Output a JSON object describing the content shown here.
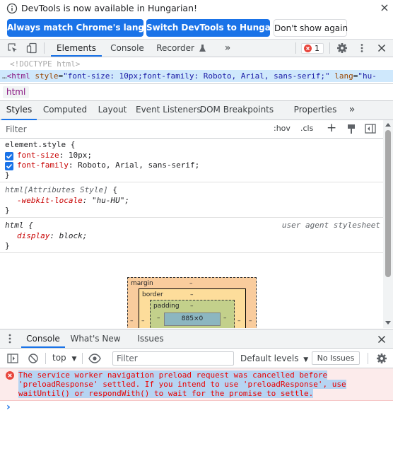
{
  "infobar": {
    "message": "DevTools is now available in Hungarian!",
    "match_button": "Always match Chrome's language",
    "switch_button": "Switch DevTools to Hungarian",
    "dont_show_button": "Don't show again",
    "close_symbol": "×"
  },
  "main_tabs": {
    "elements": "Elements",
    "console": "Console",
    "recorder": "Recorder",
    "more": "»",
    "error_count": "1"
  },
  "dom_tree": {
    "doctype": "<!DOCTYPE html>",
    "ellipsis": "…",
    "html_open": "<html",
    "attr_style_name": "style",
    "attr_style_value": "\"font-size: 10px;font-family: Roboto, Arial, sans-serif;\"",
    "attr_lang_name": "lang",
    "attr_lang_value": "\"hu-"
  },
  "breadcrumb": {
    "html": "html"
  },
  "sub_tabs": {
    "styles": "Styles",
    "computed": "Computed",
    "layout": "Layout",
    "event_listeners": "Event Listeners",
    "dom_breakpoints": "DOM Breakpoints",
    "properties": "Properties",
    "more": "»"
  },
  "styles_toolbar": {
    "filter_placeholder": "Filter",
    "hov": ":hov",
    "cls": ".cls",
    "add": "+"
  },
  "rules": {
    "element_style": {
      "selector": "element.style",
      "open": "{",
      "close": "}",
      "p1_name": "font-size",
      "p1_value": "10px;",
      "p2_name": "font-family",
      "p2_value": "Roboto, Arial, sans-serif;"
    },
    "attributes_style": {
      "selector": "html[Attributes Style]",
      "open": "{",
      "close": "}",
      "p1_name": "-webkit-locale",
      "p1_value": "\"hu-HU\";"
    },
    "ua_style": {
      "selector": "html",
      "open": "{",
      "close": "}",
      "source": "user agent stylesheet",
      "p1_name": "display",
      "p1_value": "block;"
    }
  },
  "box_model": {
    "margin_label": "margin",
    "margin_top": "–",
    "margin_left": "–",
    "margin_right": "–",
    "border_label": "border",
    "border_top": "–",
    "border_left": "–",
    "border_right": "–",
    "padding_label": "padding",
    "padding_top": "–",
    "padding_left": "–",
    "padding_right": "–",
    "content": "885×0"
  },
  "drawer_tabs": {
    "console": "Console",
    "whats_new": "What's New",
    "issues": "Issues"
  },
  "console_toolbar": {
    "context": "top",
    "filter_placeholder": "Filter",
    "levels": "Default levels",
    "no_issues": "No Issues"
  },
  "console": {
    "error_line1": "The service worker navigation preload request was cancelled before",
    "error_line2": "'preloadResponse' settled. If you intend to use 'preloadResponse', use",
    "error_line3": "waitUntil() or respondWith() to wait for the promise to settle.",
    "prompt": "›"
  },
  "colors": {
    "accent": "#1a73e8",
    "error": "#ea0000",
    "error_bg": "#fcebeb",
    "selection": "#cfe8fc"
  }
}
